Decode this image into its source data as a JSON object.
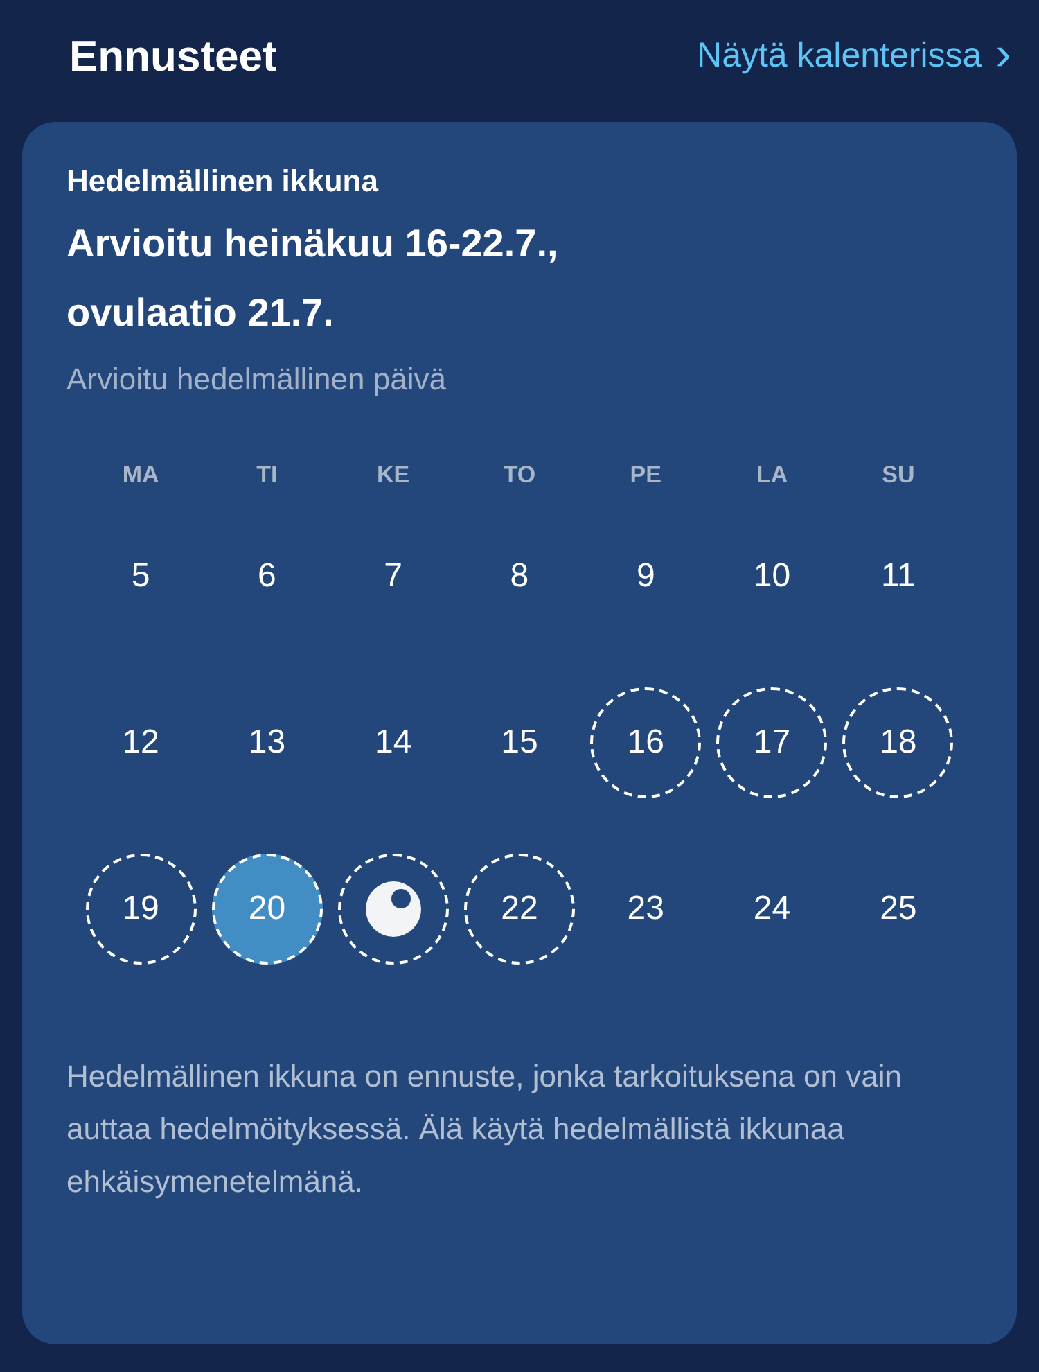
{
  "header": {
    "title": "Ennusteet",
    "link": "Näytä kalenterissa",
    "link_icon": "›"
  },
  "card": {
    "subtitle": "Hedelmällinen ikkuna",
    "title": "Arvioitu heinäkuu 16-22.7.,\novulaatio 21.7.",
    "legend": "Arvioitu hedelmällinen päivä",
    "weekdays": [
      "MA",
      "TI",
      "KE",
      "TO",
      "PE",
      "LA",
      "SU"
    ],
    "days": [
      {
        "kind": "day",
        "label": "5",
        "fertile": false,
        "selected": false
      },
      {
        "kind": "day",
        "label": "6",
        "fertile": false,
        "selected": false
      },
      {
        "kind": "day",
        "label": "7",
        "fertile": false,
        "selected": false
      },
      {
        "kind": "day",
        "label": "8",
        "fertile": false,
        "selected": false
      },
      {
        "kind": "day",
        "label": "9",
        "fertile": false,
        "selected": false
      },
      {
        "kind": "day",
        "label": "10",
        "fertile": false,
        "selected": false
      },
      {
        "kind": "day",
        "label": "11",
        "fertile": false,
        "selected": false
      },
      {
        "kind": "day",
        "label": "12",
        "fertile": false,
        "selected": false
      },
      {
        "kind": "day",
        "label": "13",
        "fertile": false,
        "selected": false
      },
      {
        "kind": "day",
        "label": "14",
        "fertile": false,
        "selected": false
      },
      {
        "kind": "day",
        "label": "15",
        "fertile": false,
        "selected": false
      },
      {
        "kind": "day",
        "label": "16",
        "fertile": true,
        "selected": false
      },
      {
        "kind": "day",
        "label": "17",
        "fertile": true,
        "selected": false
      },
      {
        "kind": "day",
        "label": "18",
        "fertile": true,
        "selected": false
      },
      {
        "kind": "day",
        "label": "19",
        "fertile": true,
        "selected": false
      },
      {
        "kind": "day",
        "label": "20",
        "fertile": true,
        "selected": true
      },
      {
        "kind": "ovulation",
        "fertile": true,
        "selected": false
      },
      {
        "kind": "day",
        "label": "22",
        "fertile": true,
        "selected": false
      },
      {
        "kind": "day",
        "label": "23",
        "fertile": false,
        "selected": false
      },
      {
        "kind": "day",
        "label": "24",
        "fertile": false,
        "selected": false
      },
      {
        "kind": "day",
        "label": "25",
        "fertile": false,
        "selected": false
      }
    ],
    "disclaimer": "Hedelmällinen ikkuna on ennuste, jonka tarkoituksena on vain auttaa hedelmöityksessä. Älä käytä hedelmällistä ikkunaa ehkäisymenetelmänä."
  }
}
